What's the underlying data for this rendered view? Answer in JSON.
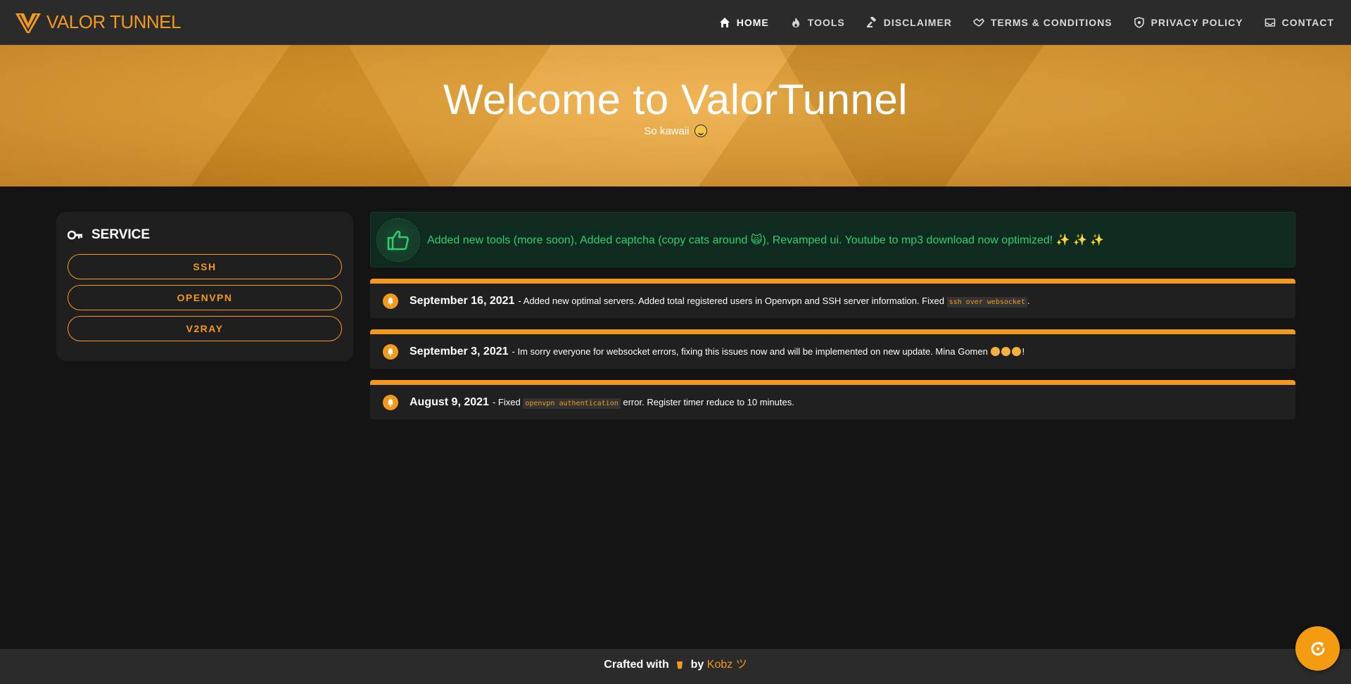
{
  "brand": {
    "name": "VALOR TUNNEL",
    "color": "#f19a1f"
  },
  "nav": {
    "items": [
      {
        "label": "HOME",
        "icon": "home-icon",
        "active": true
      },
      {
        "label": "TOOLS",
        "icon": "fire-icon"
      },
      {
        "label": "DISCLAIMER",
        "icon": "gavel-icon"
      },
      {
        "label": "TERMS & CONDITIONS",
        "icon": "handshake-icon"
      },
      {
        "label": "PRIVACY POLICY",
        "icon": "shield-icon"
      },
      {
        "label": "CONTACT",
        "icon": "inbox-icon"
      }
    ]
  },
  "hero": {
    "title": "Welcome to ValorTunnel",
    "subtitle": "So kawaii"
  },
  "sidebar": {
    "title": "SERVICE",
    "buttons": [
      "SSH",
      "OPENVPN",
      "V2RAY"
    ]
  },
  "announcement": {
    "text": "Added new tools (more soon), Added captcha (copy cats around 🙀), Revamped ui. Youtube to mp3 download now optimized! ✨ ✨ ✨",
    "color": "#2fcf6f"
  },
  "updates": [
    {
      "date": "September 16, 2021",
      "text_before": "- Added new optimal servers. Added total registered users in Openvpn and SSH server information. Fixed",
      "code": "ssh over websocket",
      "text_after": "."
    },
    {
      "date": "September 3, 2021",
      "text": "- Im sorry everyone for websocket errors, fixing this issues now and will be implemented on new update. Mina Gomen",
      "suffix": "!"
    },
    {
      "date": "August 9, 2021",
      "text_before": "- Fixed",
      "code": "openvpn authentication",
      "text_after": "error. Register timer reduce to 10 minutes."
    }
  ],
  "footer": {
    "text_before": "Crafted with",
    "text_by": "by",
    "author": "Kobz",
    "suffix": "ツ"
  },
  "colors": {
    "accent": "#f19a1f",
    "background": "#141414",
    "panel": "#202020",
    "navbar": "#2b2b2b"
  }
}
